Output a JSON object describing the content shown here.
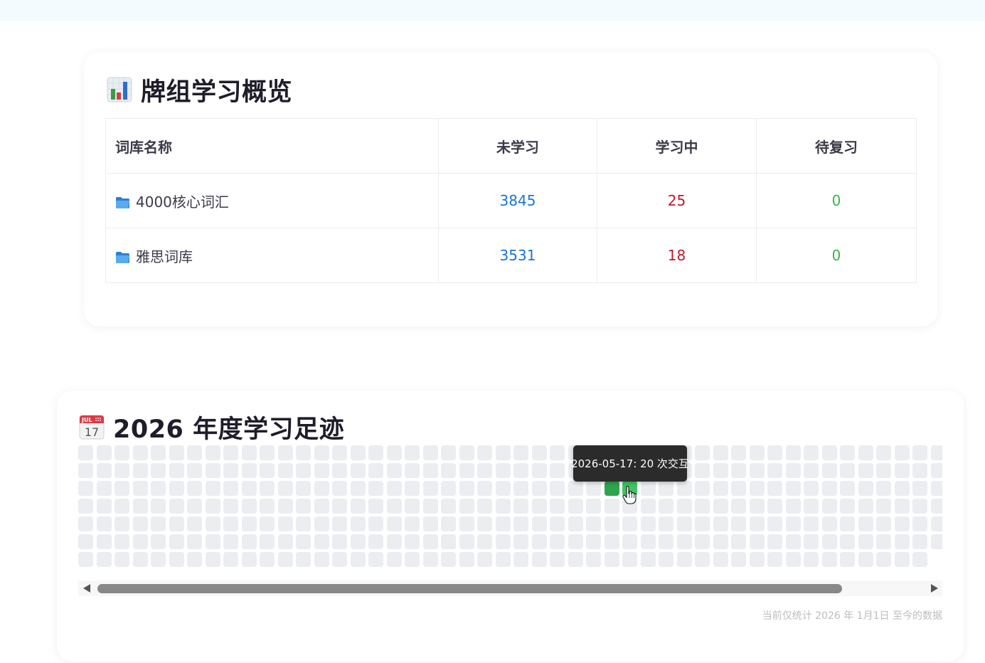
{
  "overview": {
    "title": "牌组学习概览",
    "icon": "bar-chart-icon",
    "headers": {
      "name": "词库名称",
      "new": "未学习",
      "learning": "学习中",
      "review": "待复习"
    },
    "decks": [
      {
        "name": "4000核心词汇",
        "new": "3845",
        "learning": "25",
        "review": "0"
      },
      {
        "name": "雅思词库",
        "new": "3531",
        "learning": "18",
        "review": "0"
      }
    ]
  },
  "heatmap": {
    "title": "2026 年度学习足迹",
    "icon": "calendar-icon",
    "calendar_icon_month": "JUL",
    "calendar_icon_day": "17",
    "tooltip": "2026-05-17: 20 次交互",
    "footnote": "当前仅统计 2026 年 1月1日 至今的数据",
    "colors": {
      "empty": "#ebedf0",
      "level1": "#2ea44f",
      "level2": "#40c463"
    },
    "active_days": [
      {
        "week": 29,
        "weekday": 2,
        "level": 1
      },
      {
        "week": 30,
        "weekday": 2,
        "level": 2
      }
    ]
  },
  "colors": {
    "new": "#1a73d9",
    "learning": "#c0182a",
    "review": "#3ab54a"
  }
}
